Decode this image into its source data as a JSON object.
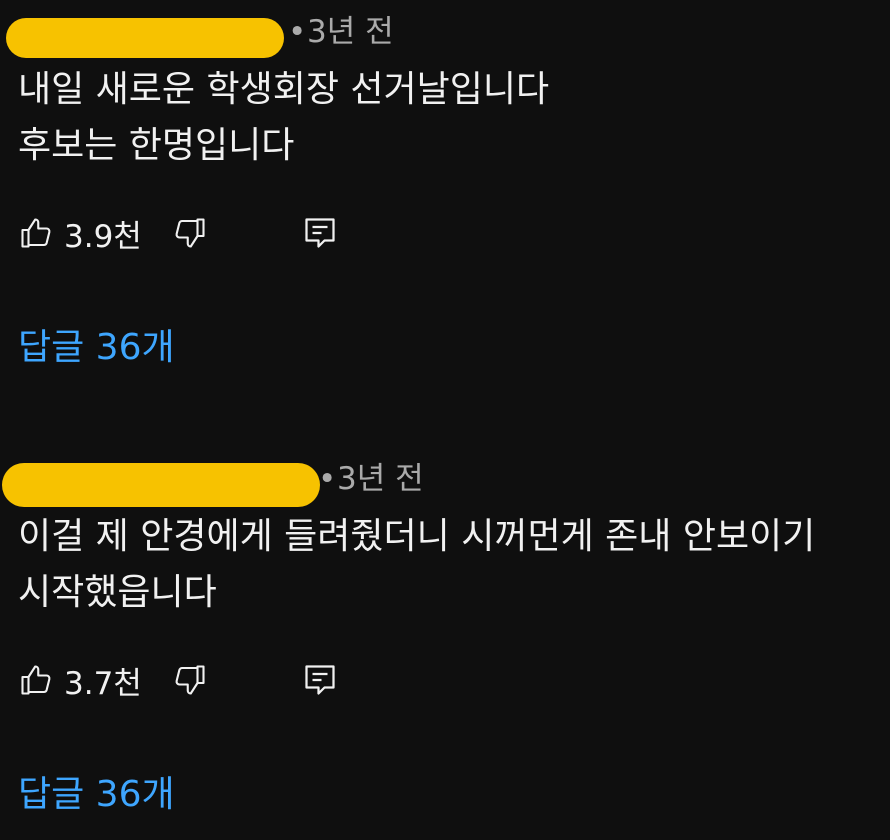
{
  "comments": [
    {
      "time_ago": "3년 전",
      "meta_fragment": "…",
      "lines": [
        "내일 새로운 학생회장 선거날입니다",
        "후보는 한명입니다"
      ],
      "likes": "3.9천",
      "replies_label": "답글 36개"
    },
    {
      "time_ago": "3년 전",
      "meta_fragment": "…",
      "lines": [
        "이걸 제 안경에게 들려줬더니 시꺼먼게 존내 안보이기",
        "시작했읍니다"
      ],
      "likes": "3.7천",
      "replies_label": "답글 36개"
    }
  ],
  "icons": {
    "like": "thumbs-up-icon",
    "dislike": "thumbs-down-icon",
    "reply": "reply-comment-icon"
  },
  "colors": {
    "background": "#0f0f0f",
    "text": "#f1f1f1",
    "meta": "#aaaaaa",
    "link": "#3ea6ff",
    "redaction": "#f7c200"
  }
}
